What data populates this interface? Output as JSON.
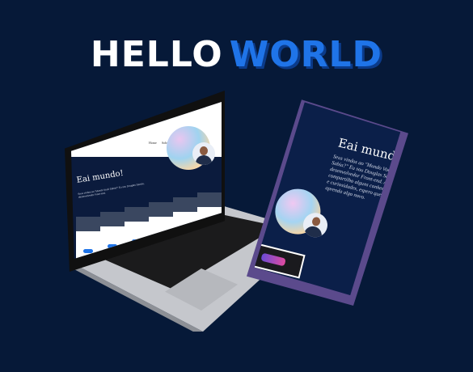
{
  "headline": {
    "word1": "HELLO",
    "word2": "WORLD"
  },
  "laptop_site": {
    "nav_items": [
      "Home",
      "Sobre mim"
    ],
    "hero_title": "Eai mundo!",
    "hero_text": "Seus vindos ao \"Mundo Você Sabia?\" Eu sou Douglas Santos, desenvolvedor Front-end.",
    "cards": 6
  },
  "phone_site": {
    "hero_title": "Eai mundo!",
    "hero_text": "Seus vindos ao \"Mundo Você Sabia?\" Eu sou Douglas Santos, desenvolvedor Front-end. Aqui compartilho alguns conhecimentos e curiosidades, espero que aprenda algo novo."
  },
  "colors": {
    "background": "#061938",
    "accent": "#1f74e8"
  }
}
